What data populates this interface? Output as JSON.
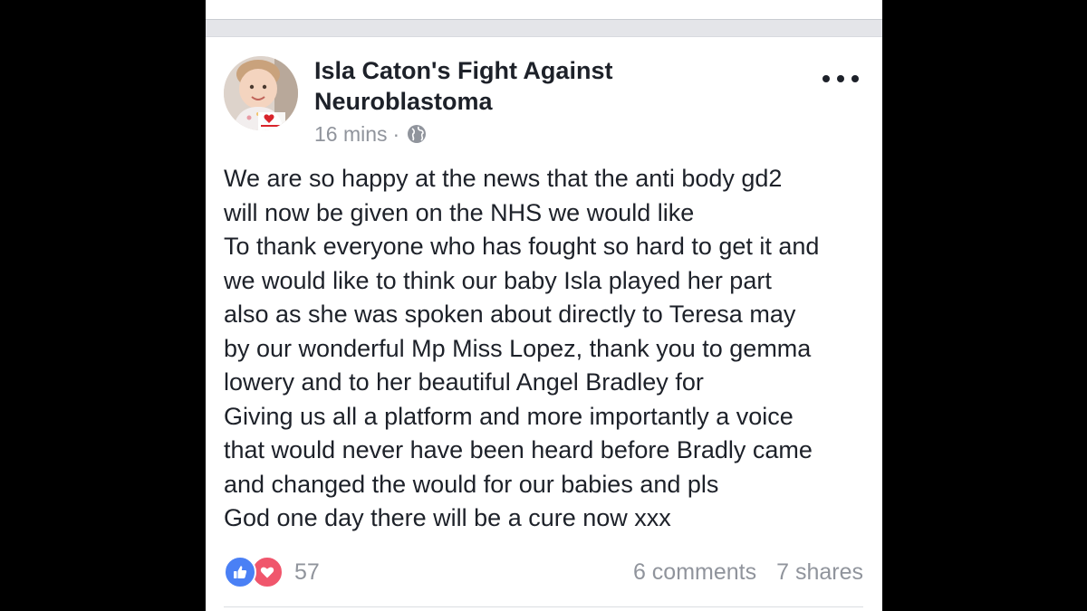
{
  "post": {
    "page_name": "Isla Caton's Fight Against Neuroblastoma",
    "page_name_lines": [
      "Isla Caton's Fight Against",
      "Neuroblastoma"
    ],
    "timestamp": "16 mins",
    "separator": "·",
    "privacy_icon": "globe-icon",
    "more_icon": "more-options-icon",
    "text_lines": [
      "We are so happy at the news that the anti body gd2",
      "will now be given on the NHS we would like",
      "To thank everyone who has fought so hard to get it and",
      "we would like to think our baby Isla played her part",
      "also as she was spoken about directly to Teresa may",
      "by our wonderful Mp Miss Lopez, thank you to gemma",
      "lowery and to her beautiful Angel Bradley for",
      "Giving us all a platform and more importantly a voice",
      "that would never have been heard before Bradly came",
      "and changed the would for our babies and pls",
      "God one day there will be a cure now xxx"
    ],
    "reactions": {
      "icons": [
        "like-icon",
        "love-icon"
      ],
      "count": "57"
    },
    "comments": "6 comments",
    "shares": "7 shares"
  },
  "colors": {
    "text_primary": "#1d2129",
    "text_secondary": "#90949c",
    "like_blue": "#4a80f5",
    "love_red": "#f0566c",
    "separator_gray": "#e4e5e9",
    "letterbox": "#000000"
  }
}
